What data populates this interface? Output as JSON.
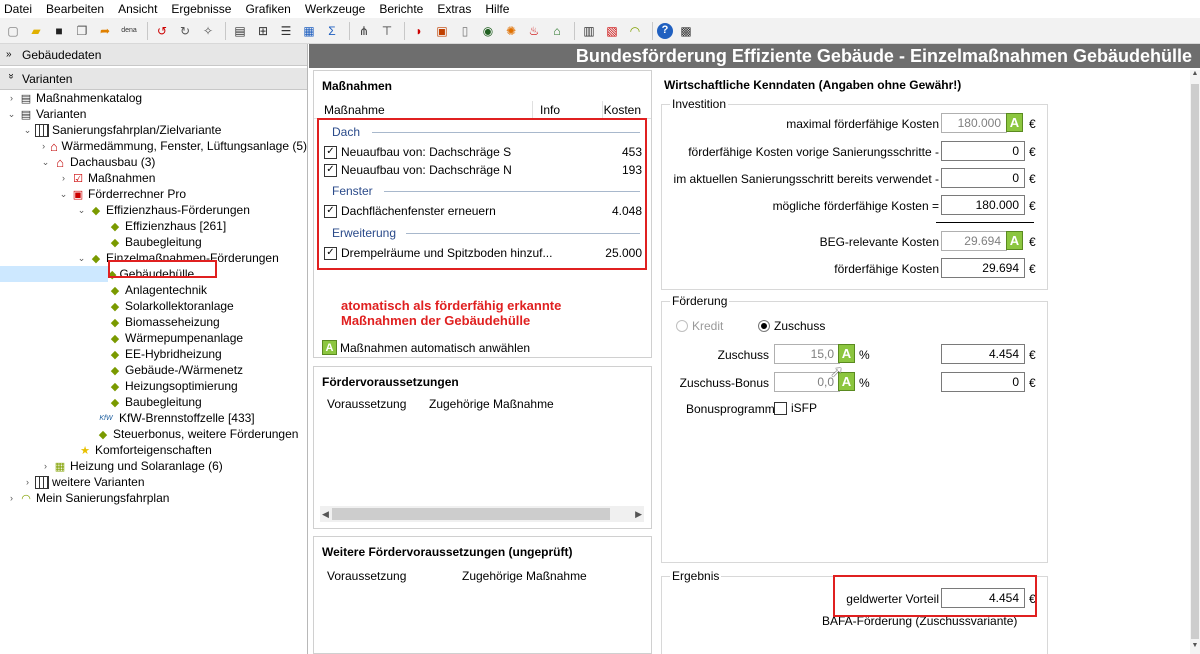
{
  "menu": [
    "Datei",
    "Bearbeiten",
    "Ansicht",
    "Ergebnisse",
    "Grafiken",
    "Werkzeuge",
    "Berichte",
    "Extras",
    "Hilfe"
  ],
  "toolbar": {
    "dena_label": "dena"
  },
  "left": {
    "gebaeudedaten": "Gebäudedaten",
    "varianten_header": "Varianten",
    "tree": [
      {
        "label": "Maßnahmenkatalog"
      },
      {
        "label": "Varianten"
      },
      {
        "label": "Sanierungsfahrplan/Zielvariante"
      },
      {
        "label": "Wärmedämmung, Fenster, Lüftungsanlage (5)"
      },
      {
        "label": "Dachausbau (3)"
      },
      {
        "label": "Maßnahmen"
      },
      {
        "label": "Förderrechner Pro"
      },
      {
        "label": "Effizienzhaus-Förderungen"
      },
      {
        "label": "Effizienzhaus [261]"
      },
      {
        "label": "Baubegleitung"
      },
      {
        "label": "Einzelmaßnahmen-Förderungen"
      },
      {
        "label": "Gebäudehülle"
      },
      {
        "label": "Anlagentechnik"
      },
      {
        "label": "Solarkollektoranlage"
      },
      {
        "label": "Biomasseheizung"
      },
      {
        "label": "Wärmepumpenanlage"
      },
      {
        "label": "EE-Hybridheizung"
      },
      {
        "label": "Gebäude-/Wärmenetz"
      },
      {
        "label": "Heizungsoptimierung"
      },
      {
        "label": "Baubegleitung"
      },
      {
        "label": "KfW-Brennstoffzelle [433]",
        "prefix": "KfW"
      },
      {
        "label": "Steuerbonus, weitere Förderungen"
      },
      {
        "label": "Komforteigenschaften"
      },
      {
        "label": "Heizung und Solaranlage (6)"
      },
      {
        "label": "weitere Varianten"
      },
      {
        "label": "Mein Sanierungsfahrplan"
      }
    ]
  },
  "main_title": "Bundesförderung Effiziente Gebäude - Einzelmaßnahmen Gebäudehülle",
  "massnahmen": {
    "title": "Maßnahmen",
    "col_name": "Maßnahme",
    "col_info": "Info",
    "col_cost": "Kosten",
    "groups": [
      {
        "name": "Dach",
        "items": [
          {
            "label": "Neuaufbau von: Dachschräge S",
            "cost": "453"
          },
          {
            "label": "Neuaufbau von: Dachschräge N",
            "cost": "193"
          }
        ]
      },
      {
        "name": "Fenster",
        "items": [
          {
            "label": "Dachflächenfenster erneuern",
            "cost": "4.048"
          }
        ]
      },
      {
        "name": "Erweiterung",
        "items": [
          {
            "label": "Drempelräume und Spitzboden hinzuf...",
            "cost": "25.000"
          }
        ]
      }
    ],
    "note": "atomatisch als förderfähig erkannte Maßnahmen der Gebäudehülle",
    "auto_select": "Maßnahmen automatisch anwählen",
    "auto_badge": "A"
  },
  "foerdervoraussetzungen": {
    "title": "Fördervoraussetzungen",
    "col1": "Voraussetzung",
    "col2": "Zugehörige Maßnahme"
  },
  "weitere": {
    "title": "Weitere Fördervoraussetzungen (ungeprüft)",
    "col1": "Voraussetzung",
    "col2": "Zugehörige Maßnahme"
  },
  "wirtschaft": {
    "title": "Wirtschaftliche Kenndaten (Angaben ohne Gewähr!)",
    "investition": {
      "legend": "Investition",
      "rows": [
        {
          "label": "maximal förderfähige Kosten",
          "value": "180.000",
          "unit": "€"
        },
        {
          "label": "förderfähige Kosten vorige Sanierungsschritte -",
          "value": "0",
          "unit": "€"
        },
        {
          "label": "im aktuellen Sanierungsschritt bereits verwendet -",
          "value": "0",
          "unit": "€"
        },
        {
          "label": "mögliche förderfähige Kosten =",
          "value": "180.000",
          "unit": "€"
        },
        {
          "label": "BEG-relevante Kosten",
          "value": "29.694",
          "unit": "€"
        },
        {
          "label": "förderfähige Kosten",
          "value": "29.694",
          "unit": "€"
        }
      ]
    },
    "foerderung": {
      "legend": "Förderung",
      "kredit": "Kredit",
      "zuschuss": "Zuschuss",
      "zuschuss_label": "Zuschuss",
      "zuschuss_pct": "15,0",
      "zuschuss_value": "4.454",
      "bonus_label": "Zuschuss-Bonus",
      "bonus_pct": "0,0",
      "bonus_value": "0",
      "pct_unit": "%",
      "eur_unit": "€",
      "bonusprogramme": "Bonusprogramme",
      "isfp": "iSFP"
    },
    "ergebnis": {
      "legend": "Ergebnis",
      "label": "geldwerter Vorteil",
      "value": "4.454",
      "unit": "€",
      "caption": "BAFA-Förderung (Zuschussvariante)"
    }
  },
  "colors": {
    "accent_green": "#8cc63f",
    "highlight_red": "#e02020",
    "header_gray": "#6e6e6e"
  }
}
